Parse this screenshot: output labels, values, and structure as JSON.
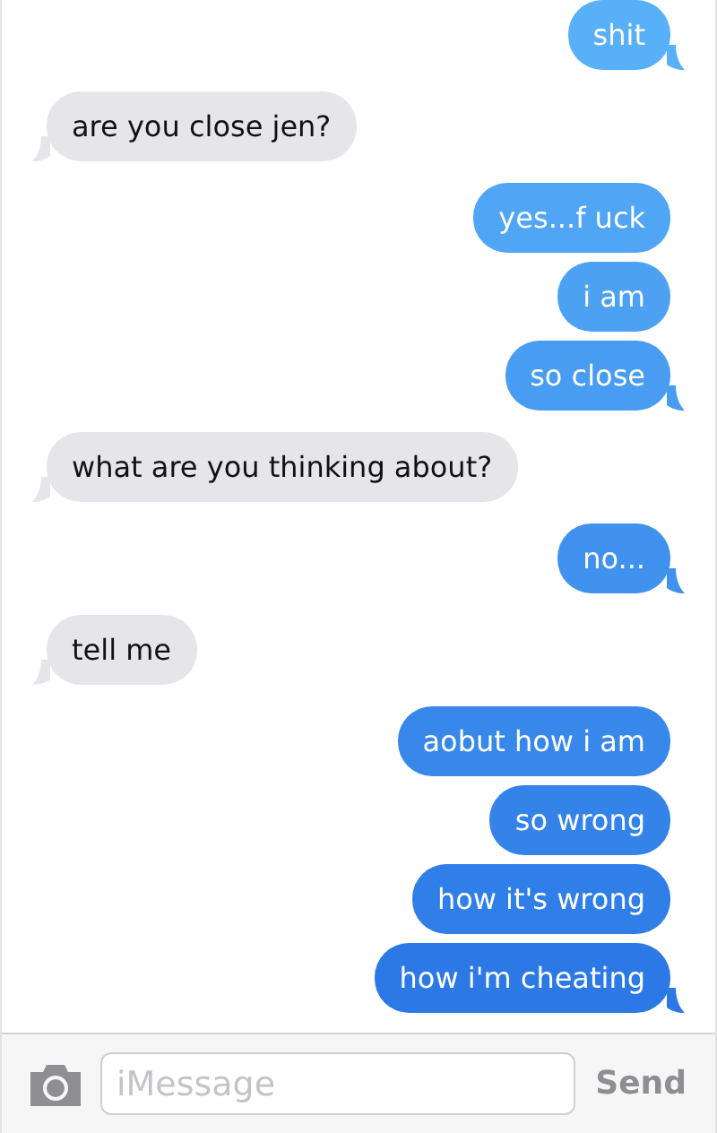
{
  "messages": [
    {
      "text": "shit",
      "kind": "sent",
      "tail": true
    },
    {
      "text": "are you close jen?",
      "kind": "received",
      "tail": true
    },
    {
      "text": "yes...f uck",
      "kind": "sent",
      "tail": false
    },
    {
      "text": "i am",
      "kind": "sent",
      "tail": false
    },
    {
      "text": "so close",
      "kind": "sent",
      "tail": true
    },
    {
      "text": "what are you thinking about?",
      "kind": "received",
      "tail": true
    },
    {
      "text": "no...",
      "kind": "sent",
      "tail": true
    },
    {
      "text": "tell me",
      "kind": "received",
      "tail": true
    },
    {
      "text": "aobut how i am",
      "kind": "sent",
      "tail": false
    },
    {
      "text": "so wrong",
      "kind": "sent",
      "tail": false
    },
    {
      "text": "how it's wrong",
      "kind": "sent",
      "tail": false
    },
    {
      "text": "how i'm cheating",
      "kind": "sent",
      "tail": true
    }
  ],
  "composer": {
    "placeholder": "iMessage",
    "send": "Send"
  }
}
